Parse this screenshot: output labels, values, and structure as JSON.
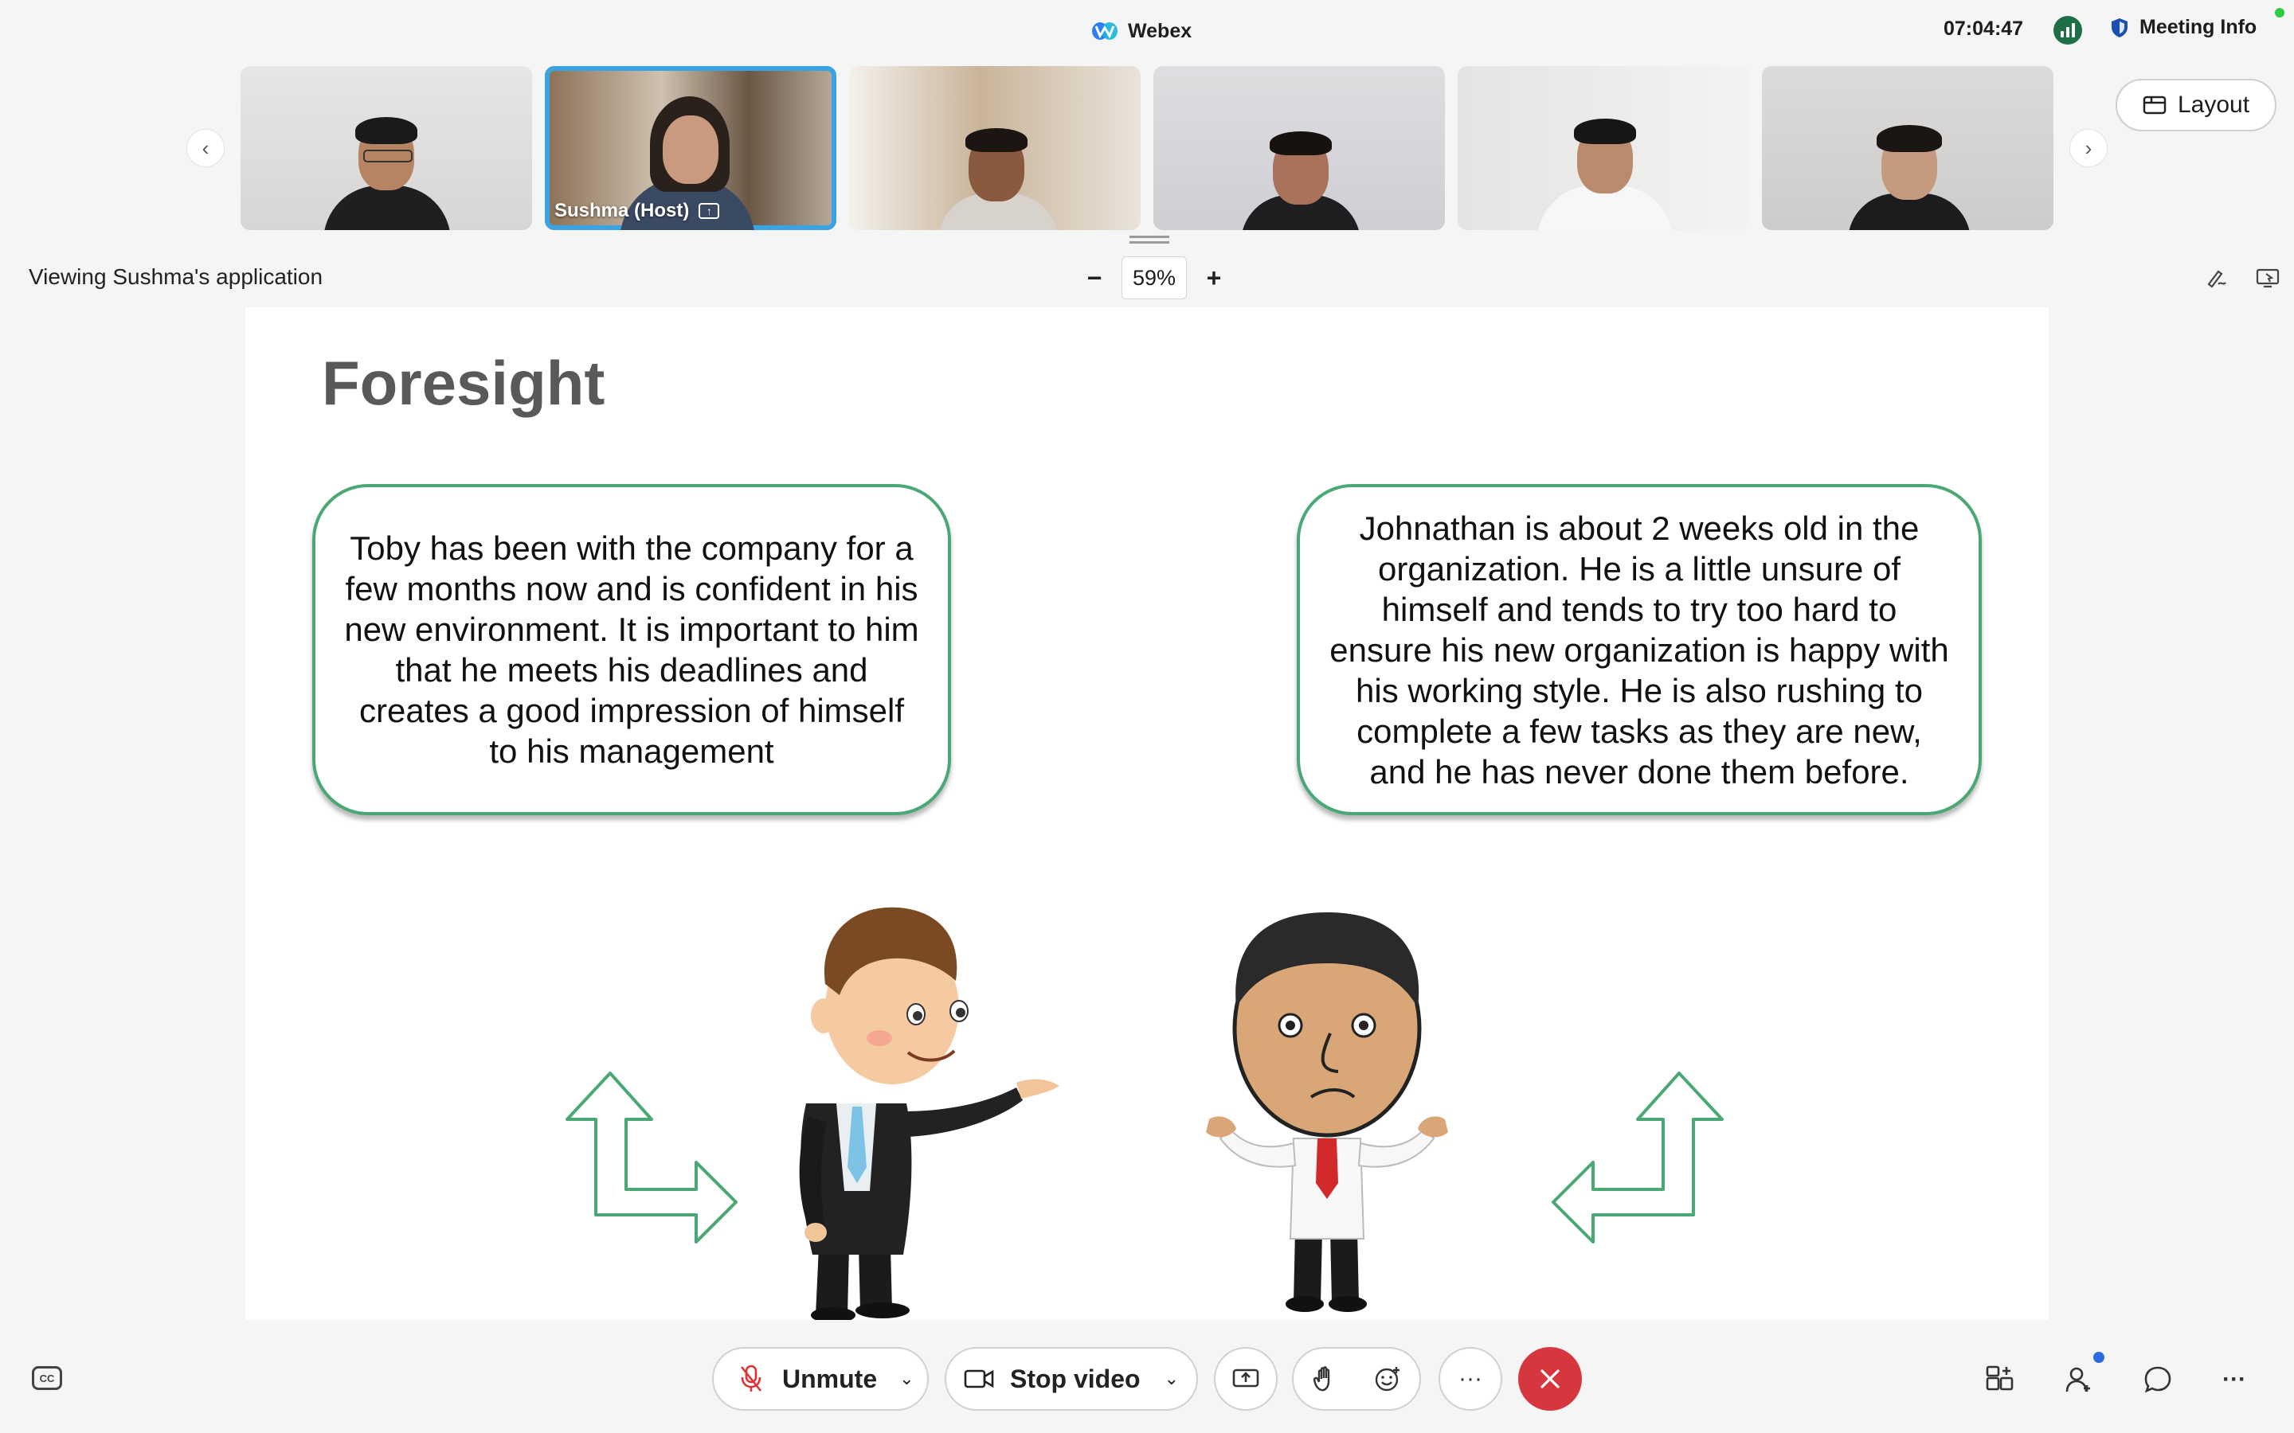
{
  "window": {
    "app_title": "Webex",
    "clock": "07:04:47",
    "meeting_info_label": "Meeting Info"
  },
  "participants": [
    {
      "name": "",
      "active": false
    },
    {
      "name": "Sushma  (Host)",
      "active": true
    },
    {
      "name": "",
      "active": false
    },
    {
      "name": "",
      "active": false
    },
    {
      "name": "",
      "active": false
    },
    {
      "name": "",
      "active": false
    }
  ],
  "layout_button": "Layout",
  "share": {
    "viewing_label": "Viewing Sushma's application",
    "zoom_minus": "−",
    "zoom_value": "59%",
    "zoom_plus": "+"
  },
  "slide": {
    "title": "Foresight",
    "left_bubble": "Toby has been with the company for a few months now and is confident in his new environment. It is important to him that he meets his deadlines and creates a good impression of himself to his management",
    "right_bubble": "Johnathan is about 2 weeks old in the organization. He is a little unsure of himself and tends to try too hard to ensure his new organization is happy with his working style. He is also rushing to complete a few tasks as they are new, and he has never done them before."
  },
  "controls": {
    "cc_label": "CC",
    "unmute_label": "Unmute",
    "stop_video_label": "Stop video",
    "more_label": "···",
    "overflow_label": "···"
  },
  "colors": {
    "accent": "#3aa3e3",
    "bubble_border": "#4aa874",
    "end_call": "#d6373f",
    "signal": "#1e6e46"
  }
}
